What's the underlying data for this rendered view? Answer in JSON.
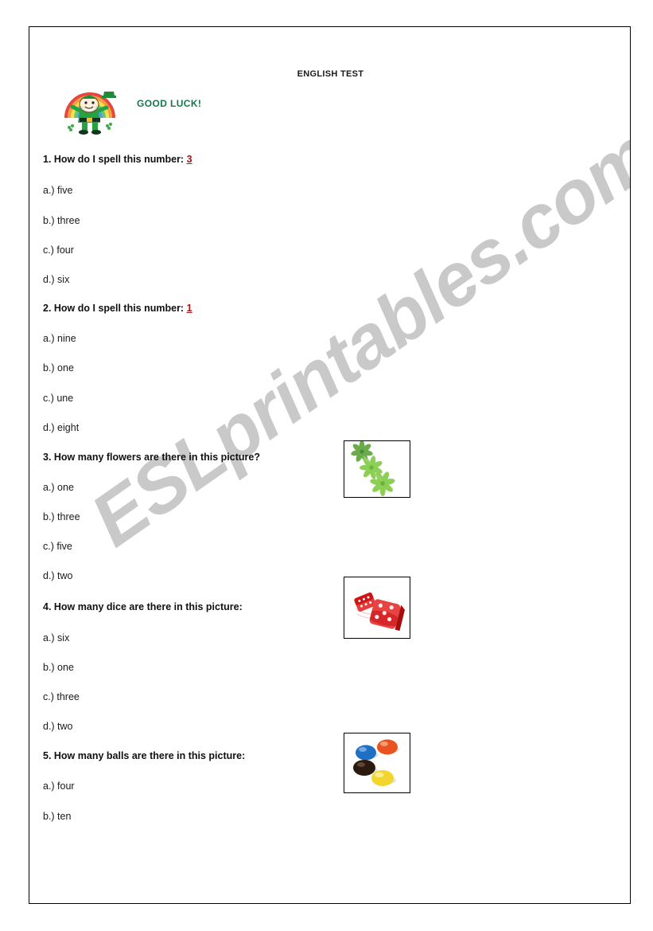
{
  "page": {
    "title": "ENGLISH TEST",
    "good_luck": "GOOD LUCK!",
    "watermark": "ESLprintables.com",
    "accent_red": "#a31515",
    "good_luck_color": "#17784e",
    "watermark_color": "#c9c9c9"
  },
  "questions": [
    {
      "prompt": "1. How do I spell this number: ",
      "cue": "3",
      "options": [
        "a.) five",
        "b.) three",
        "c.) four",
        "d.) six"
      ]
    },
    {
      "prompt": "2. How do I spell this number: ",
      "cue": "1",
      "options": [
        "a.) nine",
        "b.) one",
        "c.) une",
        "d.) eight"
      ]
    },
    {
      "prompt": "3. How many flowers are there in this picture?",
      "cue": "",
      "options": [
        "a.) one",
        "b.) three",
        "c.) five",
        "d.) two"
      ],
      "picture": "flowers-picture"
    },
    {
      "prompt": "4. How many dice are there in this picture:",
      "cue": "",
      "options": [
        "a.) six",
        "b.) one",
        "c.) three",
        "d.) two"
      ],
      "picture": "dice-picture"
    },
    {
      "prompt": "5. How many balls are there in this picture:",
      "cue": "",
      "options": [
        "a.) four",
        "b.) ten"
      ],
      "picture": "balls-picture"
    }
  ],
  "pictures": {
    "flowers": {
      "name": "flowers-picture",
      "count": 3,
      "color": "#7dc242"
    },
    "dice": {
      "name": "dice-picture",
      "count": 2,
      "color": "#cf1414"
    },
    "balls": {
      "name": "balls-picture",
      "count": 4,
      "colors": [
        "#1f6fc4",
        "#e8531f",
        "#2a1a10",
        "#f2d62e"
      ]
    }
  }
}
